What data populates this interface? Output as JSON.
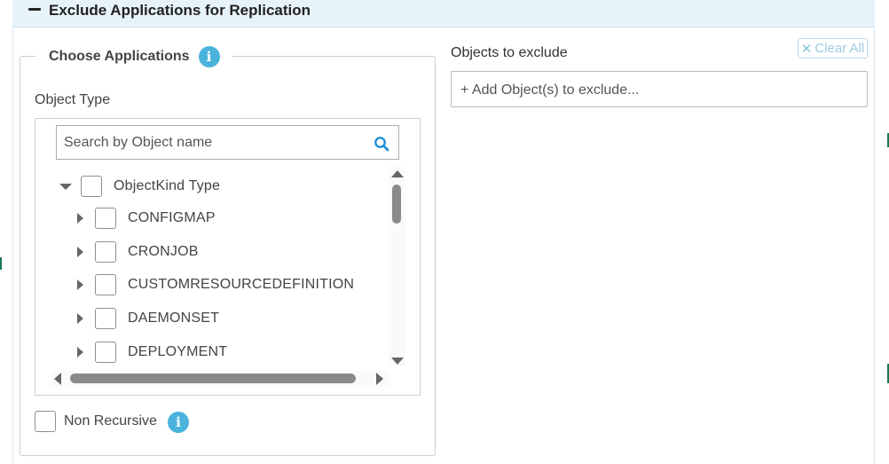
{
  "section": {
    "title": "Exclude Applications for Replication"
  },
  "choose": {
    "legend": "Choose Applications",
    "object_type_label": "Object Type",
    "search_placeholder": "Search by Object name",
    "tree": {
      "root": "ObjectKind Type",
      "children": [
        "CONFIGMAP",
        "CRONJOB",
        "CUSTOMRESOURCEDEFINITION",
        "DAEMONSET",
        "DEPLOYMENT"
      ]
    },
    "non_recursive_label": "Non Recursive"
  },
  "exclude": {
    "label": "Objects to exclude",
    "clear_all": "Clear All",
    "placeholder": "+ Add Object(s) to exclude..."
  },
  "icons": {
    "info": "i",
    "clear": "✕"
  },
  "colors": {
    "header_bg": "#e7f3fa",
    "info_blue": "#4ab3dc",
    "search_blue": "#1f8ed6"
  }
}
